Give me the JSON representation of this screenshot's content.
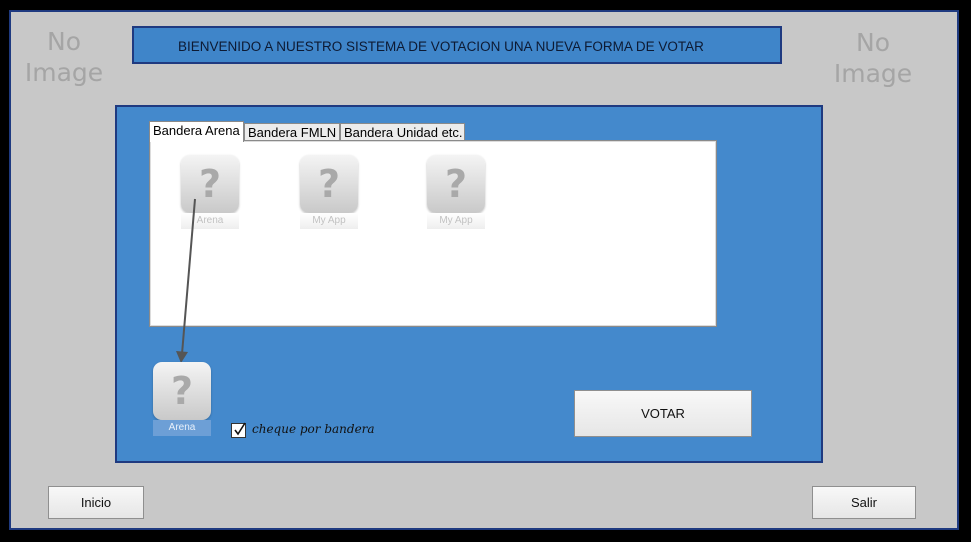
{
  "no_image_left": {
    "line1": "No",
    "line2": "Image"
  },
  "no_image_right": {
    "line1": "No",
    "line2": "Image"
  },
  "banner": {
    "text": "BIENVENIDO A NUESTRO SISTEMA DE VOTACION UNA NUEVA FORMA DE VOTAR"
  },
  "tabs": [
    {
      "label": "Bandera Arena",
      "active": true
    },
    {
      "label": "Bandera FMLN",
      "active": false
    },
    {
      "label": "Bandera Unidad etc.",
      "active": false
    }
  ],
  "tab_items": [
    {
      "label": "Arena",
      "icon": "question-mark-icon"
    },
    {
      "label": "My App",
      "icon": "question-mark-icon"
    },
    {
      "label": "My App",
      "icon": "question-mark-icon"
    }
  ],
  "selected_item": {
    "label": "Arena",
    "icon": "question-mark-icon"
  },
  "checkbox": {
    "label": "cheque por bandera",
    "checked": true
  },
  "buttons": {
    "votar": "VOTAR",
    "inicio": "Inicio",
    "salir": "Salir"
  },
  "colors": {
    "panel": "#4489cc",
    "banner": "#3f85c9",
    "frame": "#c8c8c8",
    "border": "#1f3a80"
  }
}
